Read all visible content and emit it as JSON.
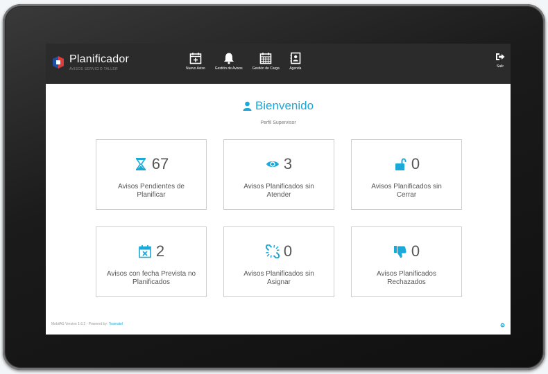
{
  "app": {
    "title": "Planificador",
    "subtitle": "AVISOS SERVICIO TALLER"
  },
  "nav": {
    "items": [
      {
        "label": "Nuevo Aviso",
        "icon": "calendar-plus-icon"
      },
      {
        "label": "Gestión de Avisos",
        "icon": "bell-icon"
      },
      {
        "label": "Gestión de Carga",
        "icon": "calendar-grid-icon"
      },
      {
        "label": "Agenda",
        "icon": "contact-book-icon"
      }
    ],
    "logout_label": "Salir"
  },
  "welcome": {
    "title": "Bienvenido",
    "profile": "Perfil Supervisor"
  },
  "cards": [
    {
      "value": "67",
      "label": "Avisos Pendientes de Planificar",
      "icon": "hourglass-icon"
    },
    {
      "value": "3",
      "label": "Avisos Planificados sin Atender",
      "icon": "eye-icon"
    },
    {
      "value": "0",
      "label": "Avisos Planificados sin Cerrar",
      "icon": "unlock-icon"
    },
    {
      "value": "2",
      "label": "Avisos con fecha Prevista no Planificados",
      "icon": "calendar-x-icon"
    },
    {
      "value": "0",
      "label": "Avisos Planificados sin Asignar",
      "icon": "broken-link-icon"
    },
    {
      "value": "0",
      "label": "Avisos Planificados Rechazados",
      "icon": "thumbs-down-icon"
    }
  ],
  "footer": {
    "version": "MobilAS Version 1.6.2 - Powered by:",
    "powered_by": "Teamatel"
  },
  "colors": {
    "accent": "#1aa9d8",
    "header_bg": "#2b2b2b",
    "text": "#555555"
  }
}
